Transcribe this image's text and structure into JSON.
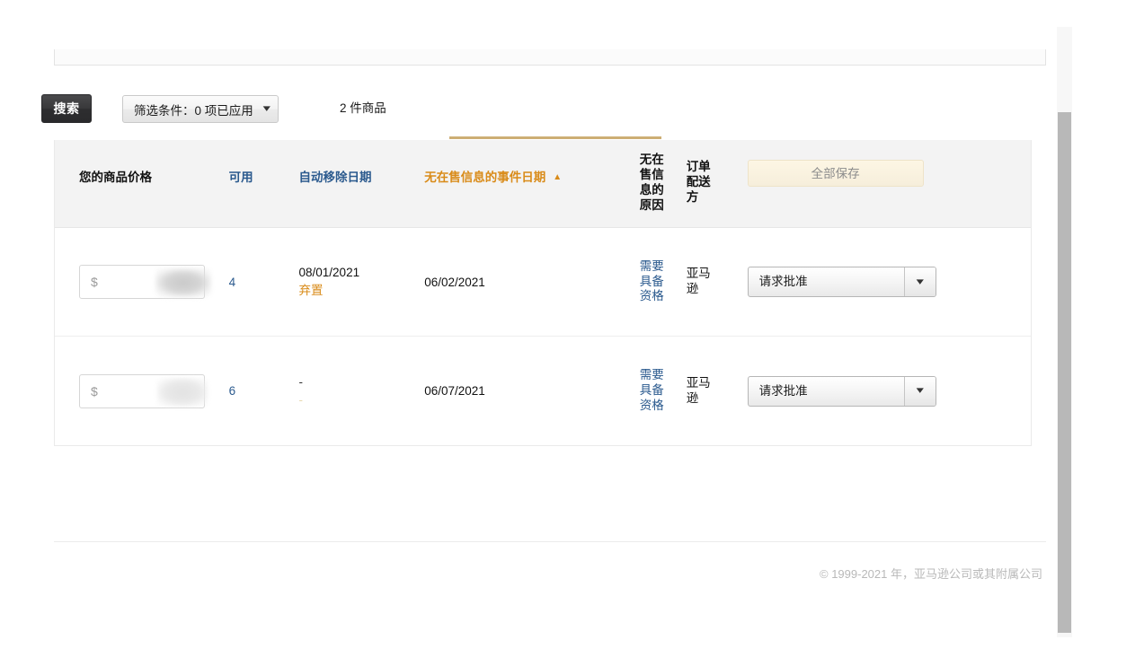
{
  "toolbar": {
    "search_label": "搜索",
    "filter_label": "筛选条件：0 项已应用",
    "filter_chevron": "chevron-down-icon",
    "item_count": "2 件商品"
  },
  "table": {
    "columns": {
      "price": "您的商品价格",
      "available": "可用",
      "auto_removal_date": "自动移除日期",
      "event_date": "无在售信息的事件日期",
      "event_date_sort": "ascending",
      "reason": "无在售信息的原因",
      "fulfilled_by": "订单配送方",
      "save_all_label": "全部保存"
    },
    "rows": [
      {
        "price_prefix": "$",
        "price_value": "",
        "price_redacted": true,
        "available": "4",
        "auto_removal_date": "08/01/2021",
        "auto_removal_status": "弃置",
        "event_date": "06/02/2021",
        "reason": "需要具备资格",
        "fulfilled_by": "亚马逊",
        "action_label": "请求批准",
        "action_chevron": "chevron-down-icon"
      },
      {
        "price_prefix": "$",
        "price_value": "",
        "price_redacted": true,
        "available": "6",
        "auto_removal_date": "-",
        "auto_removal_status": "-",
        "event_date": "06/07/2021",
        "reason": "需要具备资格",
        "fulfilled_by": "亚马逊",
        "action_label": "请求批准",
        "action_chevron": "chevron-down-icon"
      }
    ]
  },
  "footer": {
    "copyright": "© 1999-2021 年，亚马逊公司或其附属公司"
  },
  "colors": {
    "link_blue": "#2b5a8e",
    "accent_orange": "#d98b19",
    "sort_rule": "#cdae74",
    "header_bg": "#f3f3f3",
    "save_button_bg": "#fdf6e4"
  }
}
